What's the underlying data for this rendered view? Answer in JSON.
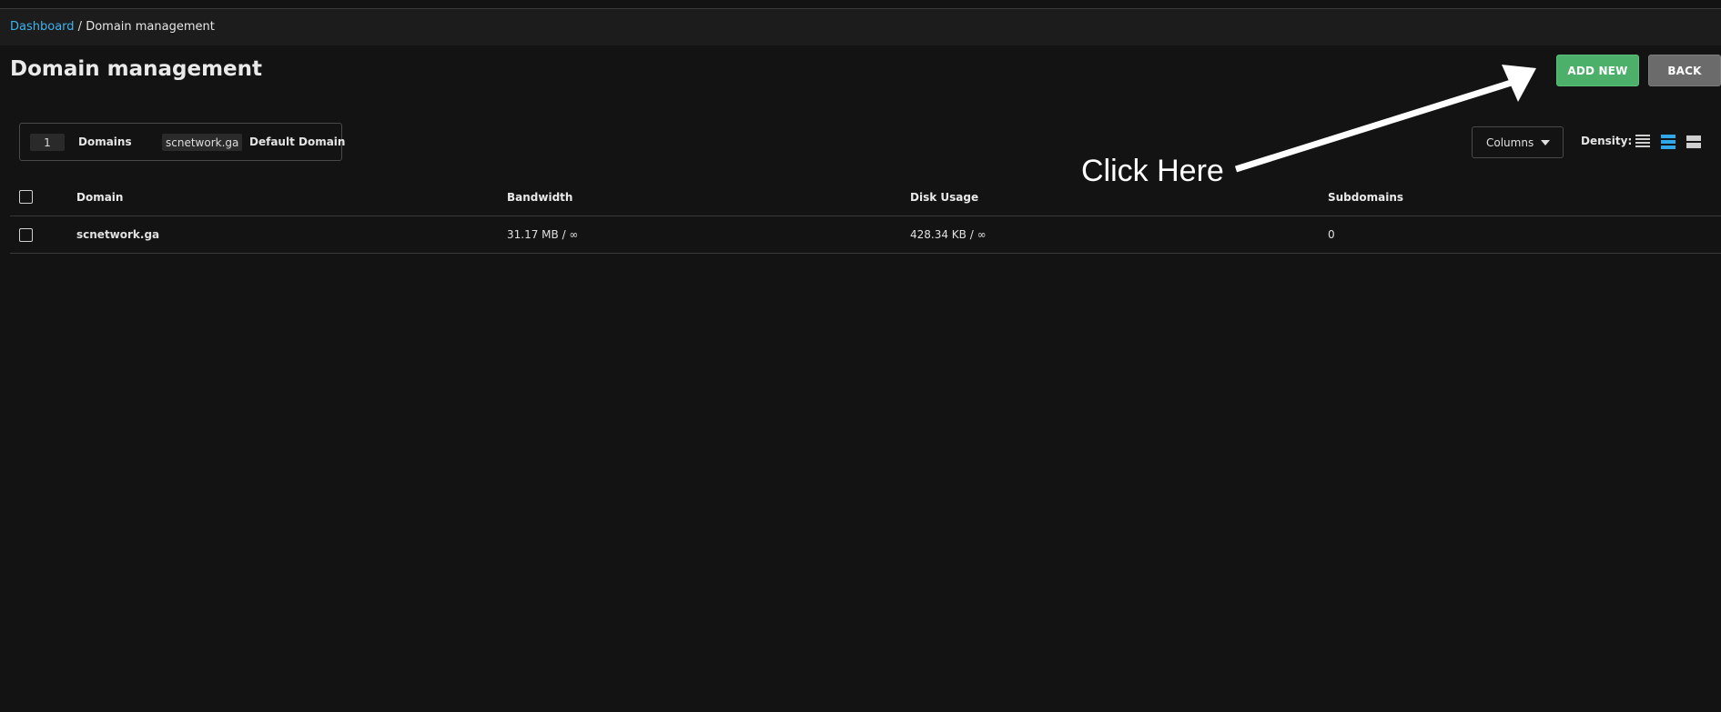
{
  "breadcrumb": {
    "dashboard": "Dashboard",
    "separator": " / ",
    "current": "Domain management"
  },
  "page": {
    "title": "Domain management"
  },
  "actions": {
    "add_new": "ADD NEW",
    "back": "BACK"
  },
  "summary": {
    "count": "1",
    "count_label": "Domains",
    "default_domain": "scnetwork.ga",
    "default_label": "Default Domain"
  },
  "toolbar": {
    "columns_label": "Columns",
    "density_label": "Density:"
  },
  "table": {
    "headers": {
      "domain": "Domain",
      "bandwidth": "Bandwidth",
      "disk": "Disk Usage",
      "subdomains": "Subdomains"
    },
    "rows": [
      {
        "domain": "scnetwork.ga",
        "bandwidth": "31.17 MB / ∞",
        "disk": "428.34 KB / ∞",
        "subdomains": "0"
      }
    ]
  },
  "annotation": {
    "text": "Click Here"
  },
  "colors": {
    "accent_link": "#3fb3ee",
    "add_button": "#4caf6a",
    "back_button": "#6b6b6b",
    "density_active": "#2ea8e8",
    "background": "#131313"
  }
}
